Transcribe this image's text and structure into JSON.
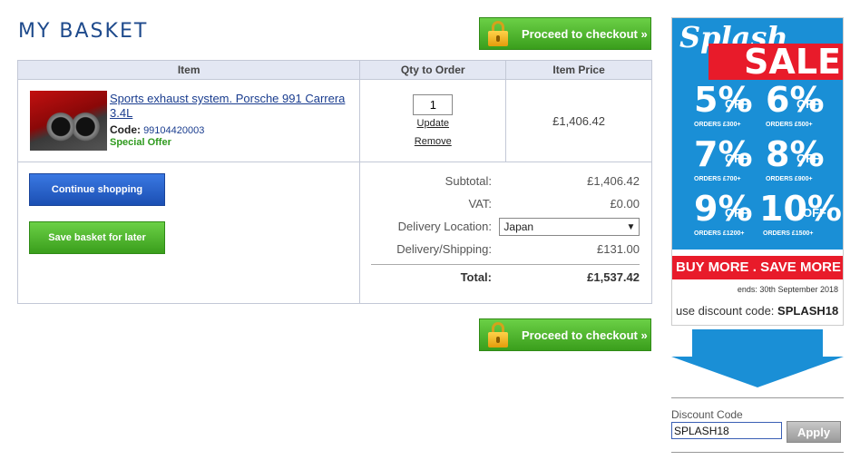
{
  "header": {
    "title": "MY BASKET"
  },
  "checkout": {
    "label": "Proceed to checkout »"
  },
  "table": {
    "headers": {
      "item": "Item",
      "qty": "Qty to Order",
      "price": "Item Price"
    },
    "row": {
      "name": "Sports exhaust system. Porsche 991 Carrera 3.4L",
      "code_label": "Code:",
      "code": "99104420003",
      "special": "Special Offer",
      "qty": "1",
      "update": "Update",
      "remove": "Remove",
      "price": "£1,406.42"
    }
  },
  "actions": {
    "continue": "Continue shopping",
    "save": "Save basket for later"
  },
  "totals": {
    "subtotal_label": "Subtotal:",
    "subtotal": "£1,406.42",
    "vat_label": "VAT:",
    "vat": "£0.00",
    "location_label": "Delivery Location:",
    "location": "Japan",
    "shipping_label": "Delivery/Shipping:",
    "shipping": "£131.00",
    "total_label": "Total:",
    "total": "£1,537.42"
  },
  "banner": {
    "splash": "Splash",
    "sale": "SALE",
    "discounts": [
      {
        "pct": "5%",
        "off": "OFF",
        "orders": "ORDERS £300+"
      },
      {
        "pct": "6%",
        "off": "OFF",
        "orders": "ORDERS £500+"
      },
      {
        "pct": "7%",
        "off": "OFF",
        "orders": "ORDERS £700+"
      },
      {
        "pct": "8%",
        "off": "OFF",
        "orders": "ORDERS £900+"
      },
      {
        "pct": "9%",
        "off": "OFF",
        "orders": "ORDERS £1200+"
      },
      {
        "pct": "10%",
        "off": "OFF",
        "orders": "ORDERS £1500+"
      }
    ],
    "buymore": "BUY MORE . SAVE MORE",
    "ends": "ends: 30th September 2018",
    "code_prefix": "use discount code:",
    "code": "SPLASH18",
    "colors": {
      "blue": "#1a8fd6",
      "red": "#e81b2a"
    }
  },
  "discount": {
    "label": "Discount Code",
    "value": "SPLASH18",
    "apply": "Apply"
  }
}
